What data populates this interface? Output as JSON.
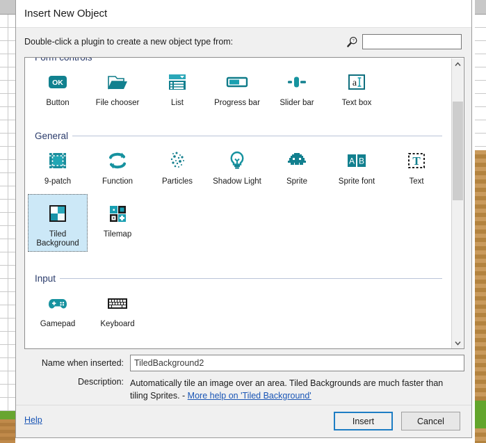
{
  "dialog": {
    "title": "Insert New Object",
    "prompt": "Double-click a plugin to create a new object type from:",
    "search": {
      "value": "",
      "placeholder": "",
      "icon": "search-help-icon"
    }
  },
  "groups": [
    {
      "name": "Form controls",
      "items": [
        {
          "label": "Button",
          "icon": "ok-button-icon"
        },
        {
          "label": "File chooser",
          "icon": "folder-open-icon"
        },
        {
          "label": "List",
          "icon": "list-dropdown-icon"
        },
        {
          "label": "Progress bar",
          "icon": "progress-bar-icon"
        },
        {
          "label": "Slider bar",
          "icon": "slider-bar-icon"
        },
        {
          "label": "Text box",
          "icon": "text-box-icon"
        }
      ]
    },
    {
      "name": "General",
      "items": [
        {
          "label": "9-patch",
          "icon": "nine-patch-icon"
        },
        {
          "label": "Function",
          "icon": "function-arrows-icon"
        },
        {
          "label": "Particles",
          "icon": "particles-icon"
        },
        {
          "label": "Shadow Light",
          "icon": "lightbulb-icon"
        },
        {
          "label": "Sprite",
          "icon": "sprite-invader-icon"
        },
        {
          "label": "Sprite font",
          "icon": "sprite-font-ab-icon"
        },
        {
          "label": "Text",
          "icon": "text-t-icon"
        },
        {
          "label": "Tiled Background",
          "icon": "tiled-background-icon",
          "selected": true
        },
        {
          "label": "Tilemap",
          "icon": "tilemap-icon"
        }
      ]
    },
    {
      "name": "Input",
      "items": [
        {
          "label": "Gamepad",
          "icon": "gamepad-icon"
        },
        {
          "label": "Keyboard",
          "icon": "keyboard-icon"
        }
      ]
    }
  ],
  "scrollbar": {
    "up_arrow": "⌃",
    "down_arrow": "⌄"
  },
  "fields": {
    "name_label": "Name when inserted:",
    "name_value": "TiledBackground2",
    "name_placeholder": "",
    "description_label": "Description:",
    "description_text": "Automatically tile an image over an area.  Tiled Backgrounds are much faster than tiling Sprites. - ",
    "description_link": "More help on 'Tiled Background'"
  },
  "footer": {
    "help_label": "Help",
    "insert_label": "Insert",
    "cancel_label": "Cancel"
  },
  "colors": {
    "accent_teal": "#12808f",
    "selection_blue": "#cce8f7",
    "link_blue": "#1955b5",
    "group_heading": "#2a3b6b",
    "primary_border": "#1d7dc4"
  }
}
